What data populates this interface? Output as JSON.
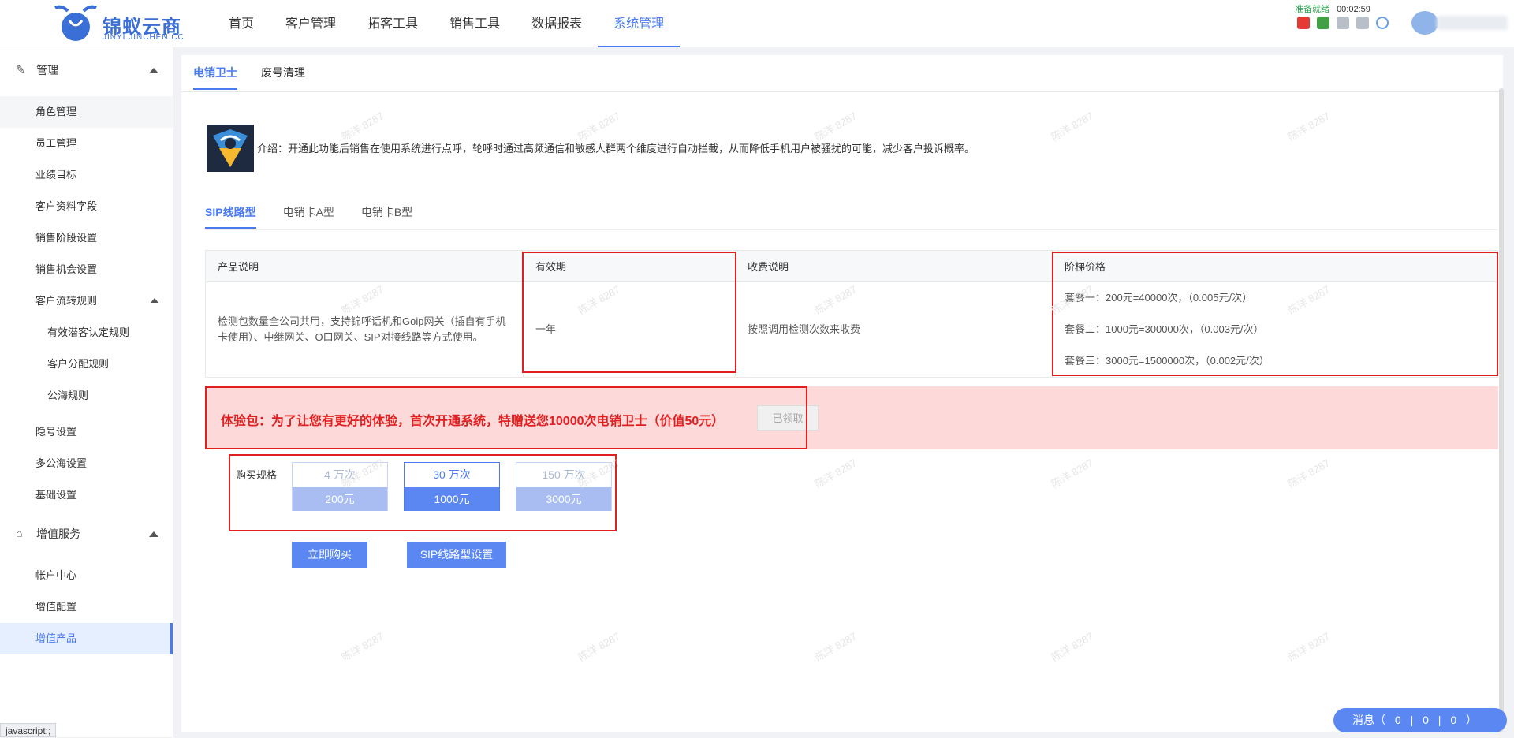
{
  "header": {
    "brand": "锦蚁云商",
    "brand_sub": "JINYI.JINCHEN.CC",
    "nav": [
      "首页",
      "客户管理",
      "拓客工具",
      "销售工具",
      "数据报表",
      "系统管理"
    ],
    "nav_active": 5,
    "status_ready": "准备就绪",
    "status_time": "00:02:59",
    "colors": {
      "accent": "#4a7af0",
      "hangup": "#e53935",
      "call": "#43a047"
    }
  },
  "sidebar": {
    "group_manage": "管理",
    "manage_items": [
      "角色管理",
      "员工管理",
      "业绩目标",
      "客户资料字段",
      "销售阶段设置",
      "销售机会设置"
    ],
    "flow_rules": "客户流转规则",
    "flow_sub": [
      "有效潜客认定规则",
      "客户分配规则",
      "公海规则"
    ],
    "other_items": [
      "隐号设置",
      "多公海设置",
      "基础设置"
    ],
    "group_value": "增值服务",
    "value_items": [
      "帐户中心",
      "增值配置",
      "增值产品"
    ]
  },
  "main": {
    "top_tabs": [
      "电销卫士",
      "废号清理"
    ],
    "intro": "介绍：开通此功能后销售在使用系统进行点呼，轮呼时通过高频通信和敏感人群两个维度进行自动拦截，从而降低手机用户被骚扰的可能，减少客户投诉概率。",
    "sub_tabs": [
      "SIP线路型",
      "电销卡A型",
      "电销卡B型"
    ],
    "table": {
      "headers": [
        "产品说明",
        "有效期",
        "收费说明",
        "阶梯价格"
      ],
      "desc": "检测包数量全公司共用，支持锦呼话机和Goip网关（插自有手机卡使用）、中继网关、O口网关、SIP对接线路等方式使用。",
      "validity": "一年",
      "fee": "按照调用检测次数来收费",
      "tiers": [
        "套餐一：200元=40000次，（0.005元/次）",
        "套餐二：1000元=300000次，（0.003元/次）",
        "套餐三：3000元=1500000次，（0.002元/次）"
      ]
    },
    "promo": "体验包：为了让您有更好的体验，首次开通系统，特赠送您10000次电销卫士（价值50元）",
    "promo_button": "已领取",
    "spec_label": "购买规格",
    "specs": [
      {
        "qty": "4 万次",
        "price": "200元"
      },
      {
        "qty": "30 万次",
        "price": "1000元"
      },
      {
        "qty": "150 万次",
        "price": "3000元"
      }
    ],
    "spec_selected": 1,
    "buy_button": "立即购买",
    "sip_button": "SIP线路型设置",
    "watermark": "陈洋 8287"
  },
  "footer": {
    "js_status": "javascript:;",
    "msg_label": "消息（",
    "msg_counts": [
      "0",
      "0",
      "0"
    ],
    "msg_sep": "|",
    "msg_close": "）"
  }
}
